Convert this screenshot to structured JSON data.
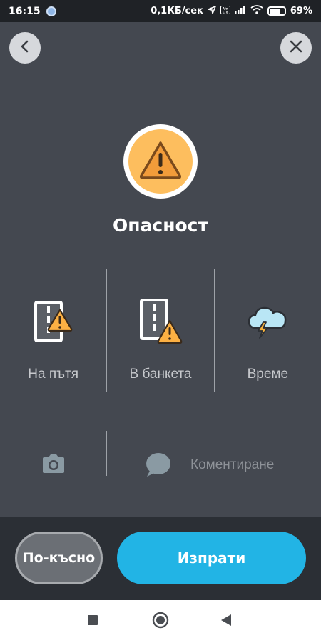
{
  "status_bar": {
    "time": "16:15",
    "network_speed": "0,1КБ/сек",
    "volte": "Vo LTE",
    "battery": "69%"
  },
  "header": {
    "back_icon": "chevron-left-icon",
    "close_icon": "close-icon"
  },
  "hero": {
    "icon": "warning-triangle-icon",
    "title": "Опасност",
    "colors": {
      "circle_fill": "#fdbe5e",
      "circle_ring": "#ffffff"
    }
  },
  "categories": [
    {
      "label": "На пътя",
      "icon": "road-hazard-icon"
    },
    {
      "label": "В банкета",
      "icon": "shoulder-hazard-icon"
    },
    {
      "label": "Време",
      "icon": "weather-storm-icon"
    }
  ],
  "comment": {
    "camera_icon": "camera-icon",
    "bubble_icon": "speech-bubble-icon",
    "placeholder": "Коментиране"
  },
  "actions": {
    "later_label": "По-късно",
    "send_label": "Изпрати",
    "send_color": "#22b4e5"
  },
  "nav_bar": {
    "recents_icon": "square-icon",
    "home_icon": "circle-icon",
    "back_icon": "triangle-back-icon"
  }
}
